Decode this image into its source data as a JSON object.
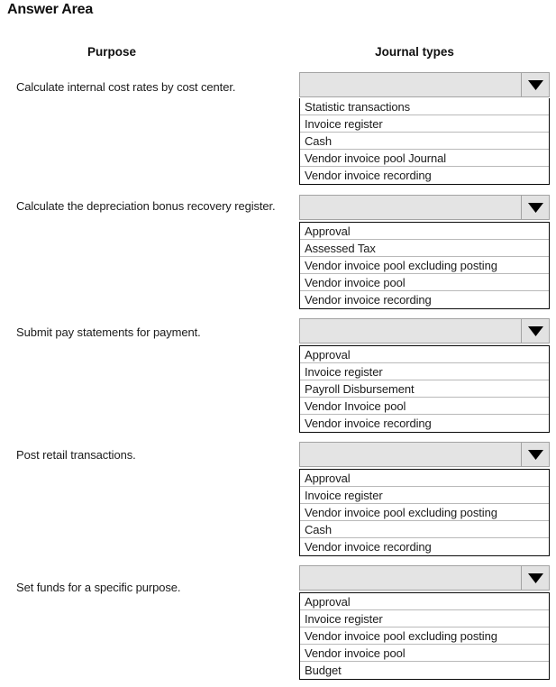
{
  "page": {
    "title": "Answer Area"
  },
  "headers": {
    "purpose": "Purpose",
    "journal_types": "Journal types"
  },
  "icons": {
    "dropdown_arrow": "chevron-down-icon"
  },
  "colors": {
    "combo_fill": "#e4e4e4",
    "combo_border": "#a3a3a3",
    "list_border": "#0a0a0a",
    "row_divider": "#b9b9b9",
    "text": "#1b1b1b",
    "page_background": "#ffffff"
  },
  "rows": [
    {
      "purpose": "Calculate internal cost rates by cost center.",
      "selected": "",
      "options": [
        "Statistic transactions",
        "Invoice register",
        "Cash",
        "Vendor invoice pool Journal",
        "Vendor invoice recording"
      ]
    },
    {
      "purpose": "Calculate the depreciation bonus recovery register.",
      "selected": "",
      "options": [
        "Approval",
        "Assessed Tax",
        "Vendor invoice pool excluding posting",
        "Vendor invoice pool",
        "Vendor invoice recording"
      ]
    },
    {
      "purpose": "Submit pay statements for payment.",
      "selected": "",
      "options": [
        "Approval",
        "Invoice register",
        "Payroll Disbursement",
        "Vendor Invoice pool",
        "Vendor invoice recording"
      ]
    },
    {
      "purpose": "Post retail transactions.",
      "selected": "",
      "options": [
        "Approval",
        "Invoice register",
        "Vendor invoice pool excluding posting",
        "Cash",
        "Vendor invoice recording"
      ]
    },
    {
      "purpose": "Set funds for a specific purpose.",
      "selected": "",
      "options": [
        "Approval",
        "Invoice register",
        "Vendor invoice pool excluding posting",
        "Vendor invoice pool",
        "Budget"
      ]
    }
  ]
}
